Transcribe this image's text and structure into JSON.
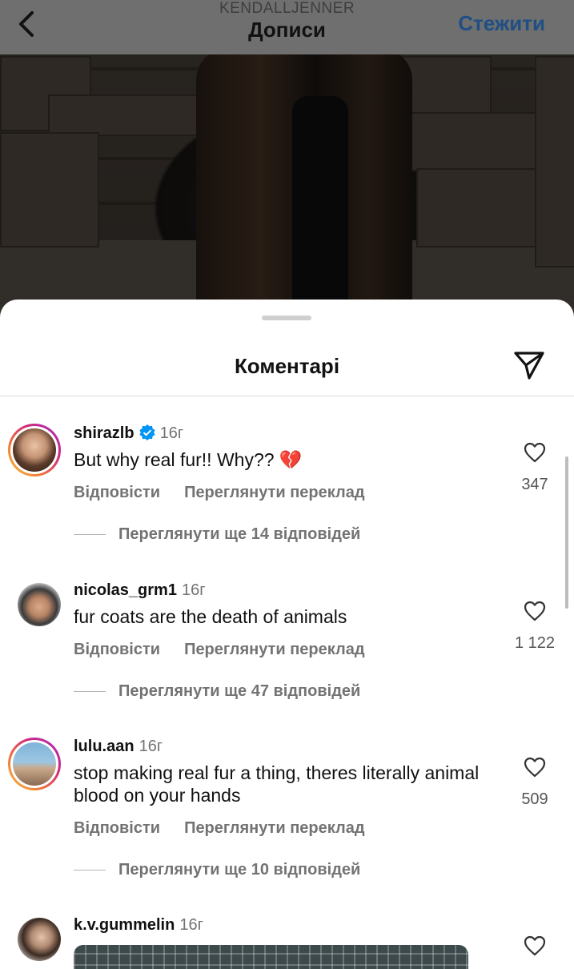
{
  "header": {
    "account": "KENDALLJENNER",
    "title": "Дописи",
    "follow_label": "Стежити"
  },
  "sheet": {
    "title": "Коментарі"
  },
  "colors": {
    "accent": "#0095f6",
    "follow_text": "#1f4f84",
    "secondary_text": "#737373"
  },
  "comments": [
    {
      "username": "shirazlb",
      "verified": true,
      "time": "16г",
      "text": "But why real fur!! Why?? 💔",
      "reply_label": "Відповісти",
      "translate_label": "Переглянути переклад",
      "more_replies": "Переглянути ще 14 відповідей",
      "likes": "347",
      "story_ring": true
    },
    {
      "username": "nicolas_grm1",
      "verified": false,
      "time": "16г",
      "text": "fur coats are the death of animals",
      "reply_label": "Відповісти",
      "translate_label": "Переглянути переклад",
      "more_replies": "Переглянути ще 47 відповідей",
      "likes": "1 122",
      "story_ring": false
    },
    {
      "username": "lulu.aan",
      "verified": false,
      "time": "16г",
      "text": "stop making real fur a thing, theres literally animal blood on your hands",
      "reply_label": "Відповісти",
      "translate_label": "Переглянути переклад",
      "more_replies": "Переглянути ще 10 відповідей",
      "likes": "509",
      "story_ring": true
    },
    {
      "username": "k.v.gummelin",
      "verified": false,
      "time": "16г",
      "story_ring": false
    }
  ]
}
